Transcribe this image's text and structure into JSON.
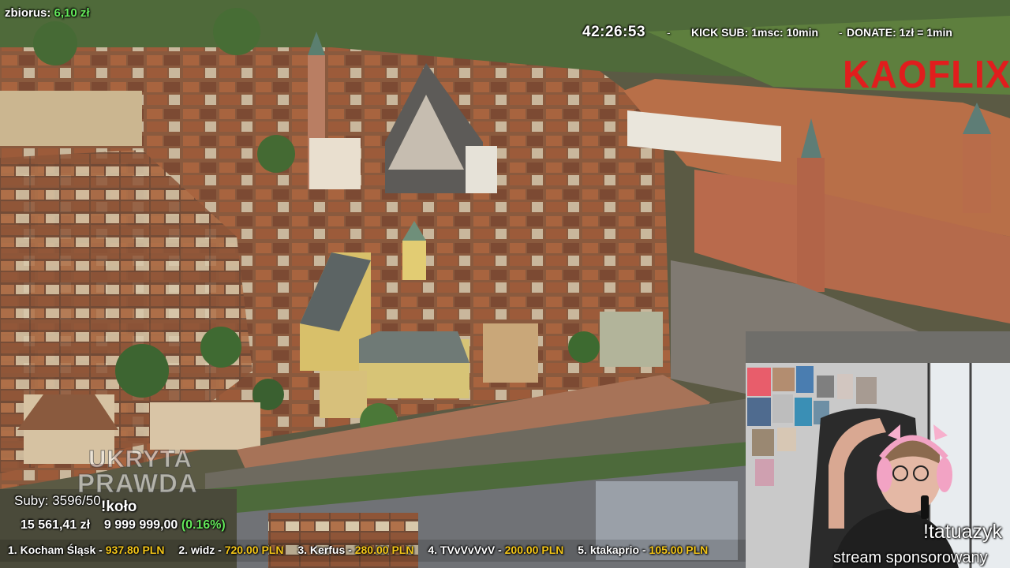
{
  "overlay": {
    "fundraiser_label": "zbiorus:",
    "fundraiser_value": "6,10 zł",
    "timer": "42:26:53",
    "separator": "-",
    "kick_sub": "KICK SUB: 1msc: 10min",
    "donate_separator": "-",
    "donate": "DONATE: 1zł = 1min",
    "logo": "KAOFLIX",
    "watermark_line1": "UKRYTA",
    "watermark_line2": "PRAWDA",
    "subs": "Suby: 3596/50",
    "command_koto": "!koło",
    "money_current": "15 561,41 zł",
    "money_target": "9 999 999,00",
    "money_percent": "(0.16%)",
    "webcam_command": "!tatuazyk",
    "sponsor_text": "stream sponsorowany"
  },
  "ticker": [
    {
      "rank": "1.",
      "name": "Kocham Śląsk",
      "amount": "937.80 PLN"
    },
    {
      "rank": "2.",
      "name": "widz",
      "amount": "720.00 PLN"
    },
    {
      "rank": "3.",
      "name": "Kerfus",
      "amount": "280.00 PLN"
    },
    {
      "rank": "4.",
      "name": "TVvVvVvV",
      "amount": "200.00 PLN"
    },
    {
      "rank": "5.",
      "name": "ktakaprio",
      "amount": "105.00 PLN"
    }
  ],
  "colors": {
    "accent_green": "#64e85a",
    "ticker_amount": "#f3c518",
    "logo_red": "#e11d1d"
  }
}
